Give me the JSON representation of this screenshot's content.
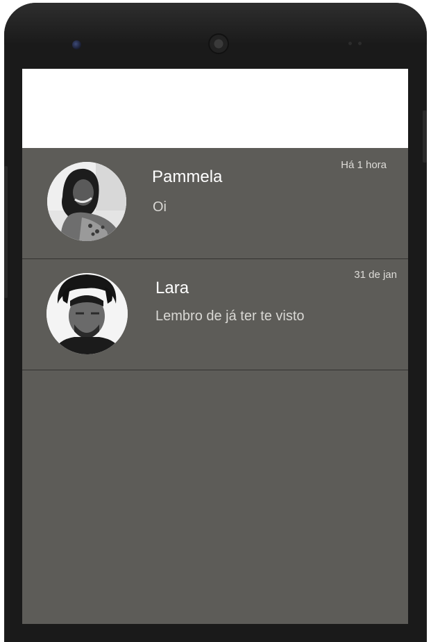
{
  "conversations": [
    {
      "name": "Pammela",
      "message": "Oi",
      "time": "Há 1 hora",
      "avatar": "person-photo-woman"
    },
    {
      "name": "Lara",
      "message": "Lembro de já ter te visto",
      "time": "31 de jan",
      "avatar": "person-photo-man"
    }
  ],
  "colors": {
    "list_background": "#5d5c58",
    "app_bar": "#ffffff",
    "phone_frame": "#1a1a1a",
    "divider": "#333230"
  }
}
